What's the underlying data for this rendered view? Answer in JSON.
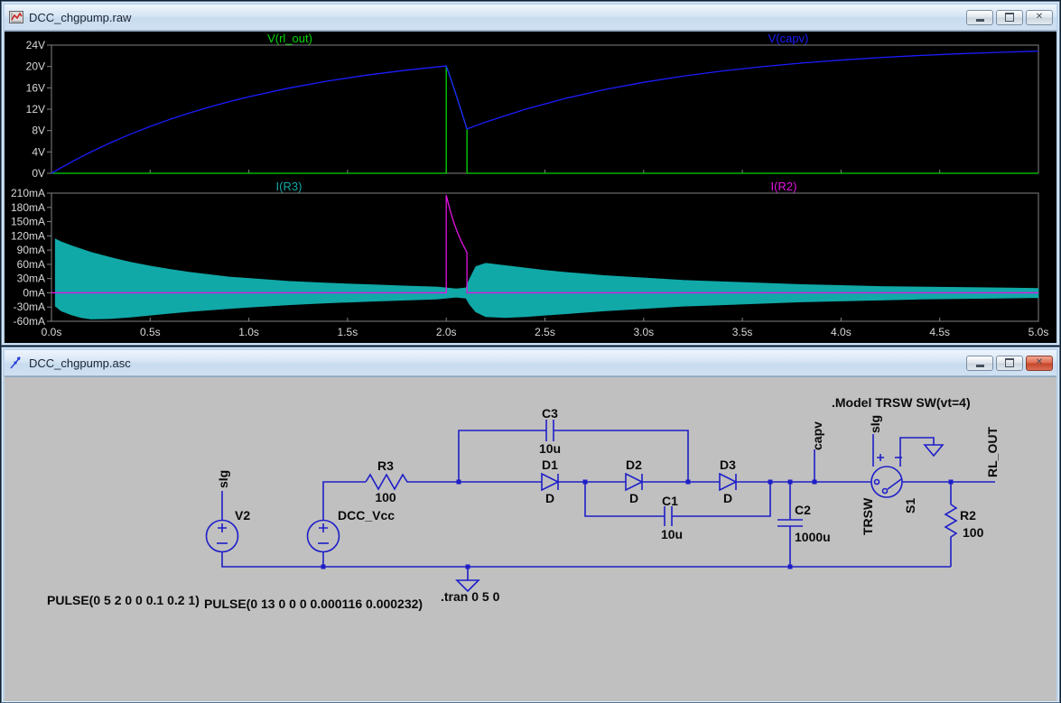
{
  "waveform_window": {
    "title": "DCC_chgpump.raw"
  },
  "schematic_window": {
    "title": "DCC_chgpump.asc",
    "labels": {
      "v2_name": "V2",
      "v2_value": "PULSE(0 5 2 0 0 0.1 0.2 1)",
      "vcc_name": "DCC_Vcc",
      "vcc_value": "PULSE(0 13 0 0 0 0.000116 0.000232)",
      "r3_name": "R3",
      "r3_value": "100",
      "c3_name": "C3",
      "c3_value": "10u",
      "d1_name": "D1",
      "d1_value": "D",
      "d2_name": "D2",
      "d2_value": "D",
      "d3_name": "D3",
      "d3_value": "D",
      "c1_name": "C1",
      "c1_value": "10u",
      "c2_name": "C2",
      "c2_value": "1000u",
      "s1_name": "S1",
      "s1_model": "TRSW",
      "r2_name": "R2",
      "r2_value": "100",
      "net_sig_v2": "sIg",
      "net_sig_s1": "sIg",
      "net_capv": "capv",
      "net_rl_out": "RL_OUT",
      "directive_model": ".Model TRSW SW(vt=4)",
      "directive_tran": ".tran 0 5 0"
    }
  },
  "x_axis": {
    "labels": [
      "0.0s",
      "0.5s",
      "1.0s",
      "1.5s",
      "2.0s",
      "2.5s",
      "3.0s",
      "3.5s",
      "4.0s",
      "4.5s",
      "5.0s"
    ],
    "values": [
      0,
      0.5,
      1,
      1.5,
      2,
      2.5,
      3,
      3.5,
      4,
      4.5,
      5
    ]
  },
  "chart_data": [
    {
      "type": "line",
      "pane": "voltage",
      "xlim": [
        0,
        5
      ],
      "ylim": [
        0,
        24
      ],
      "grid": false,
      "box": {
        "top": 46,
        "h": 142
      },
      "y_ticks": {
        "labels": [
          "24V",
          "20V",
          "16V",
          "12V",
          "8V",
          "4V",
          "0V"
        ],
        "values": [
          24,
          20,
          16,
          12,
          8,
          4,
          0
        ]
      },
      "series": [
        {
          "name": "V(rl_out)",
          "color": "#00d800",
          "label_x": 321,
          "points": [
            [
              0,
              0
            ],
            [
              2.0,
              0
            ],
            [
              2.0,
              20.1
            ],
            [
              2.02,
              18.0
            ],
            [
              2.04,
              15.8
            ],
            [
              2.06,
              13.5
            ],
            [
              2.08,
              11.2
            ],
            [
              2.105,
              8.3
            ],
            [
              2.105,
              0
            ],
            [
              5,
              0
            ]
          ]
        },
        {
          "name": "V(capv)",
          "color": "#1c1cff",
          "label_x": 873,
          "points": [
            [
              0,
              0
            ],
            [
              0.05,
              1.06
            ],
            [
              0.1,
              2.09
            ],
            [
              0.15,
              3.06
            ],
            [
              0.2,
              3.99
            ],
            [
              0.3,
              5.73
            ],
            [
              0.4,
              7.32
            ],
            [
              0.5,
              8.77
            ],
            [
              0.6,
              10.09
            ],
            [
              0.7,
              11.3
            ],
            [
              0.8,
              12.4
            ],
            [
              0.9,
              13.41
            ],
            [
              1.0,
              14.33
            ],
            [
              1.2,
              15.94
            ],
            [
              1.4,
              17.28
            ],
            [
              1.6,
              18.39
            ],
            [
              1.8,
              19.32
            ],
            [
              2.0,
              20.1
            ],
            [
              2.02,
              18.0
            ],
            [
              2.04,
              15.8
            ],
            [
              2.06,
              13.5
            ],
            [
              2.08,
              11.2
            ],
            [
              2.105,
              8.3
            ],
            [
              2.2,
              9.6
            ],
            [
              2.4,
              11.98
            ],
            [
              2.6,
              13.99
            ],
            [
              2.8,
              15.65
            ],
            [
              3.0,
              17.04
            ],
            [
              3.2,
              18.19
            ],
            [
              3.4,
              19.16
            ],
            [
              3.6,
              19.97
            ],
            [
              3.8,
              20.64
            ],
            [
              4.0,
              21.2
            ],
            [
              4.2,
              21.67
            ],
            [
              4.4,
              22.06
            ],
            [
              4.6,
              22.38
            ],
            [
              4.8,
              22.65
            ],
            [
              5.0,
              22.88
            ]
          ]
        }
      ]
    },
    {
      "type": "line",
      "pane": "current",
      "xlim": [
        0,
        5
      ],
      "ylim": [
        -60,
        210
      ],
      "grid": false,
      "box": {
        "top": 210,
        "h": 142
      },
      "y_ticks": {
        "labels": [
          "210mA",
          "180mA",
          "150mA",
          "120mA",
          "90mA",
          "60mA",
          "30mA",
          "0mA",
          "-30mA",
          "-60mA"
        ],
        "values": [
          210,
          180,
          150,
          120,
          90,
          60,
          30,
          0,
          -30,
          -60
        ]
      },
      "series": [
        {
          "name": "I(R3)",
          "color": "#11a8a8",
          "label_x": 320,
          "band": true,
          "upper": [
            [
              0.02,
              113
            ],
            [
              0.05,
              107
            ],
            [
              0.1,
              99
            ],
            [
              0.2,
              85
            ],
            [
              0.3,
              74
            ],
            [
              0.4,
              64
            ],
            [
              0.5,
              56
            ],
            [
              0.6,
              49
            ],
            [
              0.7,
              43
            ],
            [
              0.8,
              38
            ],
            [
              0.9,
              33
            ],
            [
              1.0,
              30
            ],
            [
              1.2,
              24
            ],
            [
              1.4,
              20
            ],
            [
              1.6,
              17
            ],
            [
              1.8,
              14
            ],
            [
              1.95,
              12
            ],
            [
              2.0,
              10
            ],
            [
              2.05,
              8
            ],
            [
              2.1,
              10
            ],
            [
              2.12,
              30
            ],
            [
              2.15,
              55
            ],
            [
              2.2,
              62
            ],
            [
              2.3,
              57
            ],
            [
              2.4,
              52
            ],
            [
              2.5,
              47
            ],
            [
              2.6,
              43
            ],
            [
              2.8,
              36
            ],
            [
              3.0,
              31
            ],
            [
              3.2,
              26
            ],
            [
              3.4,
              23
            ],
            [
              3.6,
              20
            ],
            [
              3.8,
              17
            ],
            [
              4.0,
              15
            ],
            [
              4.2,
              13
            ],
            [
              4.4,
              12
            ],
            [
              4.6,
              11
            ],
            [
              4.8,
              10
            ],
            [
              5.0,
              9
            ]
          ],
          "lower": [
            [
              0.02,
              -28
            ],
            [
              0.05,
              -38
            ],
            [
              0.1,
              -46
            ],
            [
              0.15,
              -52
            ],
            [
              0.2,
              -55
            ],
            [
              0.3,
              -54
            ],
            [
              0.4,
              -51
            ],
            [
              0.5,
              -47
            ],
            [
              0.6,
              -43
            ],
            [
              0.7,
              -39
            ],
            [
              0.8,
              -36
            ],
            [
              0.9,
              -33
            ],
            [
              1.0,
              -30
            ],
            [
              1.2,
              -25
            ],
            [
              1.4,
              -21
            ],
            [
              1.6,
              -18
            ],
            [
              1.8,
              -15
            ],
            [
              1.95,
              -13
            ],
            [
              2.0,
              -11
            ],
            [
              2.05,
              -9
            ],
            [
              2.1,
              -11
            ],
            [
              2.12,
              -25
            ],
            [
              2.15,
              -40
            ],
            [
              2.2,
              -50
            ],
            [
              2.3,
              -52
            ],
            [
              2.4,
              -50
            ],
            [
              2.5,
              -47
            ],
            [
              2.6,
              -44
            ],
            [
              2.8,
              -38
            ],
            [
              3.0,
              -33
            ],
            [
              3.2,
              -28
            ],
            [
              3.4,
              -25
            ],
            [
              3.6,
              -22
            ],
            [
              3.8,
              -19
            ],
            [
              4.0,
              -17
            ],
            [
              4.2,
              -15
            ],
            [
              4.4,
              -13
            ],
            [
              4.6,
              -12
            ],
            [
              4.8,
              -11
            ],
            [
              5.0,
              -10
            ]
          ]
        },
        {
          "name": "I(R2)",
          "color": "#e212e2",
          "label_x": 868,
          "points": [
            [
              0,
              0
            ],
            [
              2.0,
              0
            ],
            [
              2.0,
              205
            ],
            [
              2.02,
              173
            ],
            [
              2.04,
              146
            ],
            [
              2.06,
              124
            ],
            [
              2.08,
              105
            ],
            [
              2.105,
              85
            ],
            [
              2.105,
              0
            ],
            [
              5,
              0
            ]
          ]
        }
      ]
    }
  ]
}
